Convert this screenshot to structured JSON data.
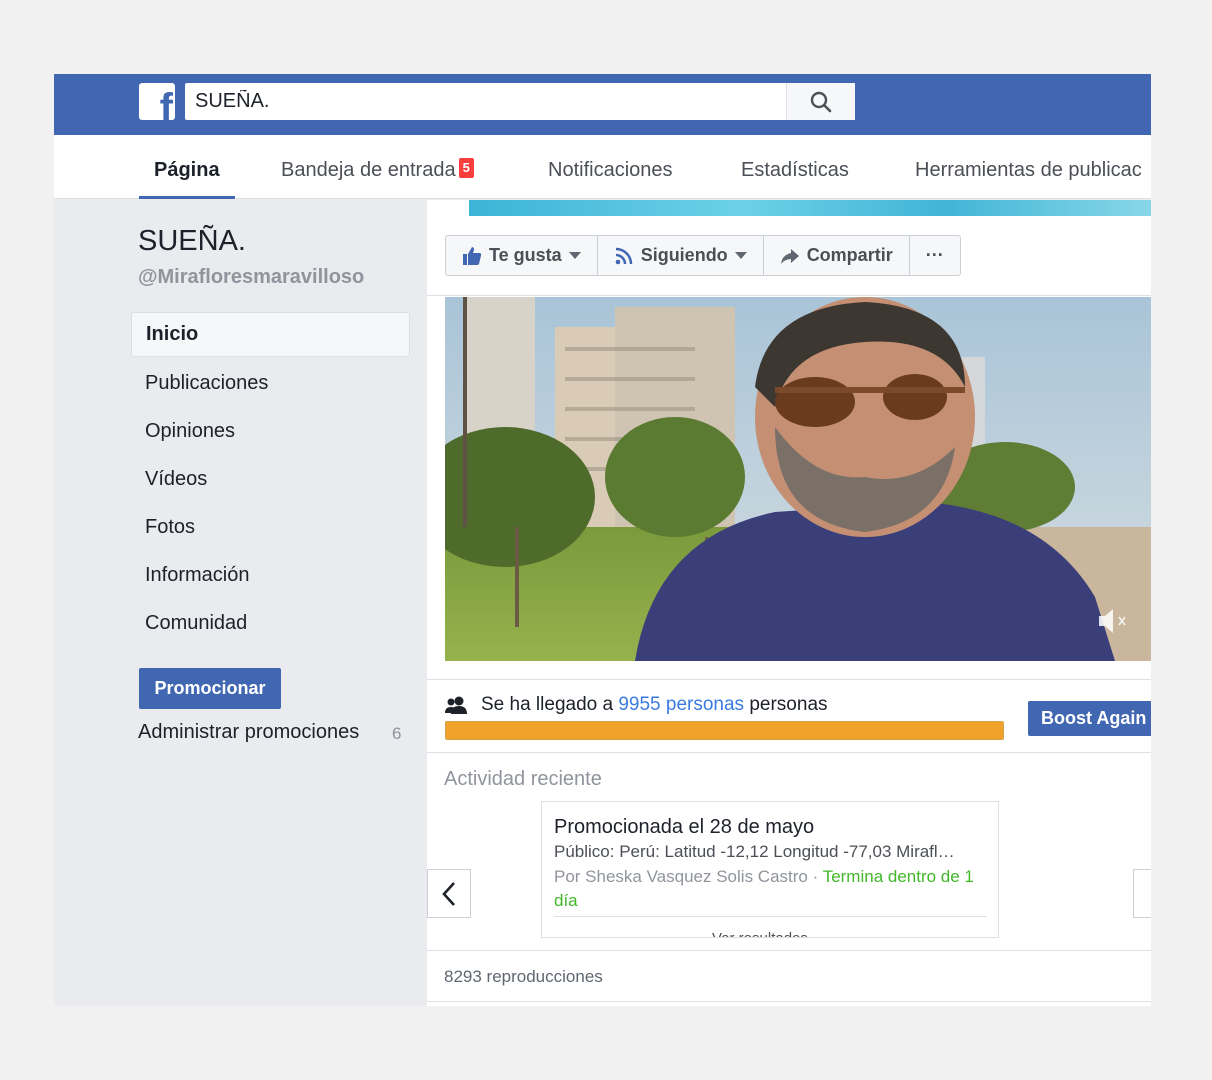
{
  "topbar": {
    "logo_letter": "f",
    "search_value": "SUEÑA.",
    "search_icon": "search-icon"
  },
  "tabs": [
    {
      "label": "Página",
      "active": true
    },
    {
      "label": "Bandeja de entrada",
      "badge": "5"
    },
    {
      "label": "Notificaciones"
    },
    {
      "label": "Estadísticas"
    },
    {
      "label": "Herramientas de publicac"
    }
  ],
  "sidebar": {
    "page_name": "SUEÑA.",
    "handle": "@Mirafloresmaravilloso",
    "items": [
      {
        "label": "Inicio",
        "active": true
      },
      {
        "label": "Publicaciones"
      },
      {
        "label": "Opiniones"
      },
      {
        "label": "Vídeos"
      },
      {
        "label": "Fotos"
      },
      {
        "label": "Información"
      },
      {
        "label": "Comunidad"
      }
    ],
    "promote_label": "Promocionar",
    "manage_label": "Administrar promociones",
    "manage_count": "6"
  },
  "actions": {
    "like": "Te gusta",
    "following": "Siguiendo",
    "share": "Compartir",
    "more": "···"
  },
  "reach": {
    "prefix": "Se ha llegado a",
    "link": "9955 personas",
    "suffix": "personas",
    "progress_fraction": 1.0,
    "boost_label": "Boost Again"
  },
  "activity": {
    "title": "Actividad reciente",
    "promo_title": "Promocionada el 28 de mayo",
    "audience": "Público: Perú: Latitud -12,12 Longitud -77,03 Mirafl…",
    "by": "Por Sheska Vasquez Solis Castro",
    "dot": " · ",
    "ends": "Termina dentro de 1 día",
    "results_link": "Ver resultados"
  },
  "views": "8293 reproducciones",
  "colors": {
    "brand": "#4267b2",
    "progress": "#f0a22a",
    "link": "#3b7be0",
    "green": "#42b72a"
  }
}
